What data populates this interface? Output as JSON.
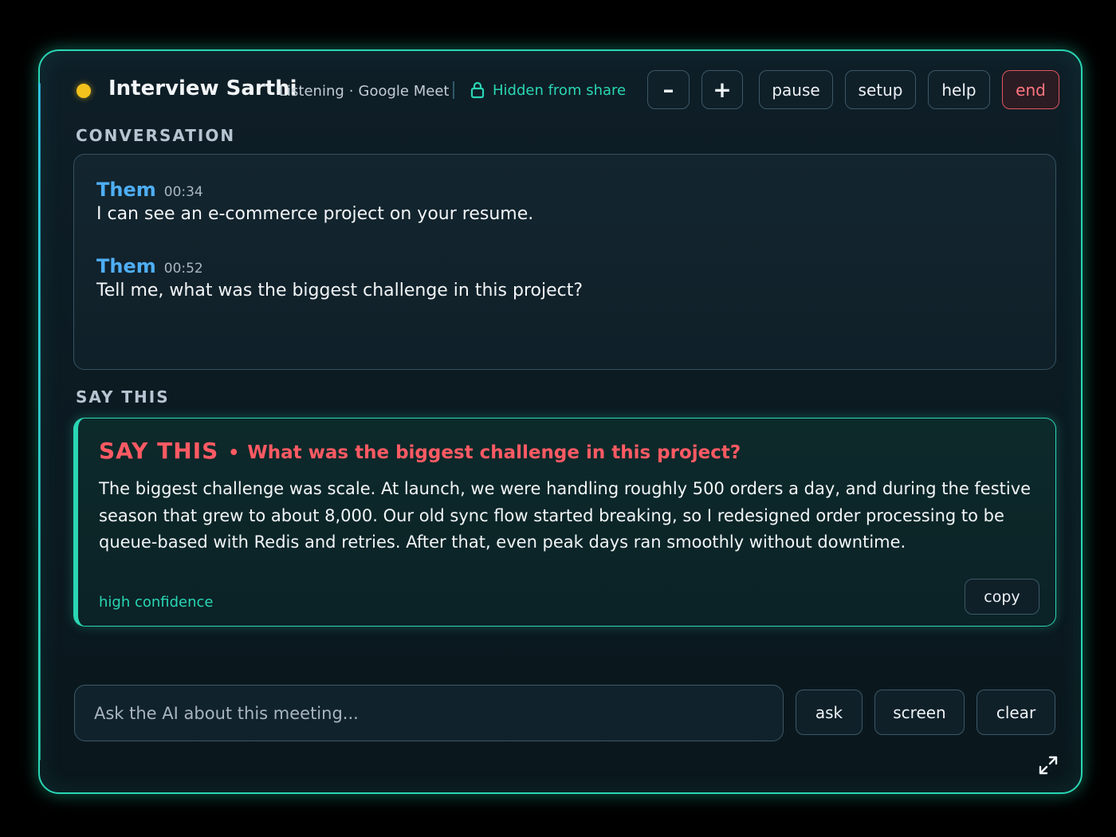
{
  "header": {
    "app_title": "Interview Sarthi",
    "status": "Listening",
    "separator": "·",
    "source": "Google Meet",
    "share_status": "Hidden from share",
    "status_dot_color": "#f4c21c",
    "buttons": {
      "zoom_out": "–",
      "zoom_in": "+",
      "pause": "pause",
      "setup": "setup",
      "help": "help",
      "end": "end"
    }
  },
  "conversation": {
    "section_label": "CONVERSATION",
    "messages": [
      {
        "speaker": "Them",
        "time": "00:34",
        "text": "I can see an e-commerce project on your resume."
      },
      {
        "speaker": "Them",
        "time": "00:52",
        "text": "Tell me, what was the biggest challenge in this project?"
      }
    ]
  },
  "say_this": {
    "section_label": "SAY THIS",
    "tag": "SAY THIS",
    "bullet": "•",
    "question": "What was the biggest challenge in this project?",
    "answer": "The biggest challenge was scale. At launch, we were handling roughly 500 orders a day, and during the festive season that grew to about 8,000. Our old sync flow started breaking, so I redesigned order processing to be queue-based with Redis and retries. After that, even peak days ran smoothly without downtime.",
    "confidence": "high confidence",
    "copy_label": "copy"
  },
  "ask_bar": {
    "placeholder": "Ask the AI about this meeting...",
    "value": "",
    "ask_label": "ask",
    "screen_label": "screen",
    "clear_label": "clear"
  },
  "colors": {
    "accent": "#2ad6b4",
    "speaker": "#4eaef5",
    "say_this": "#ff5a63",
    "end_button": "#e05560"
  },
  "icons": {
    "status": "status-dot",
    "share": "lock-icon",
    "corner": "expand-icon"
  }
}
